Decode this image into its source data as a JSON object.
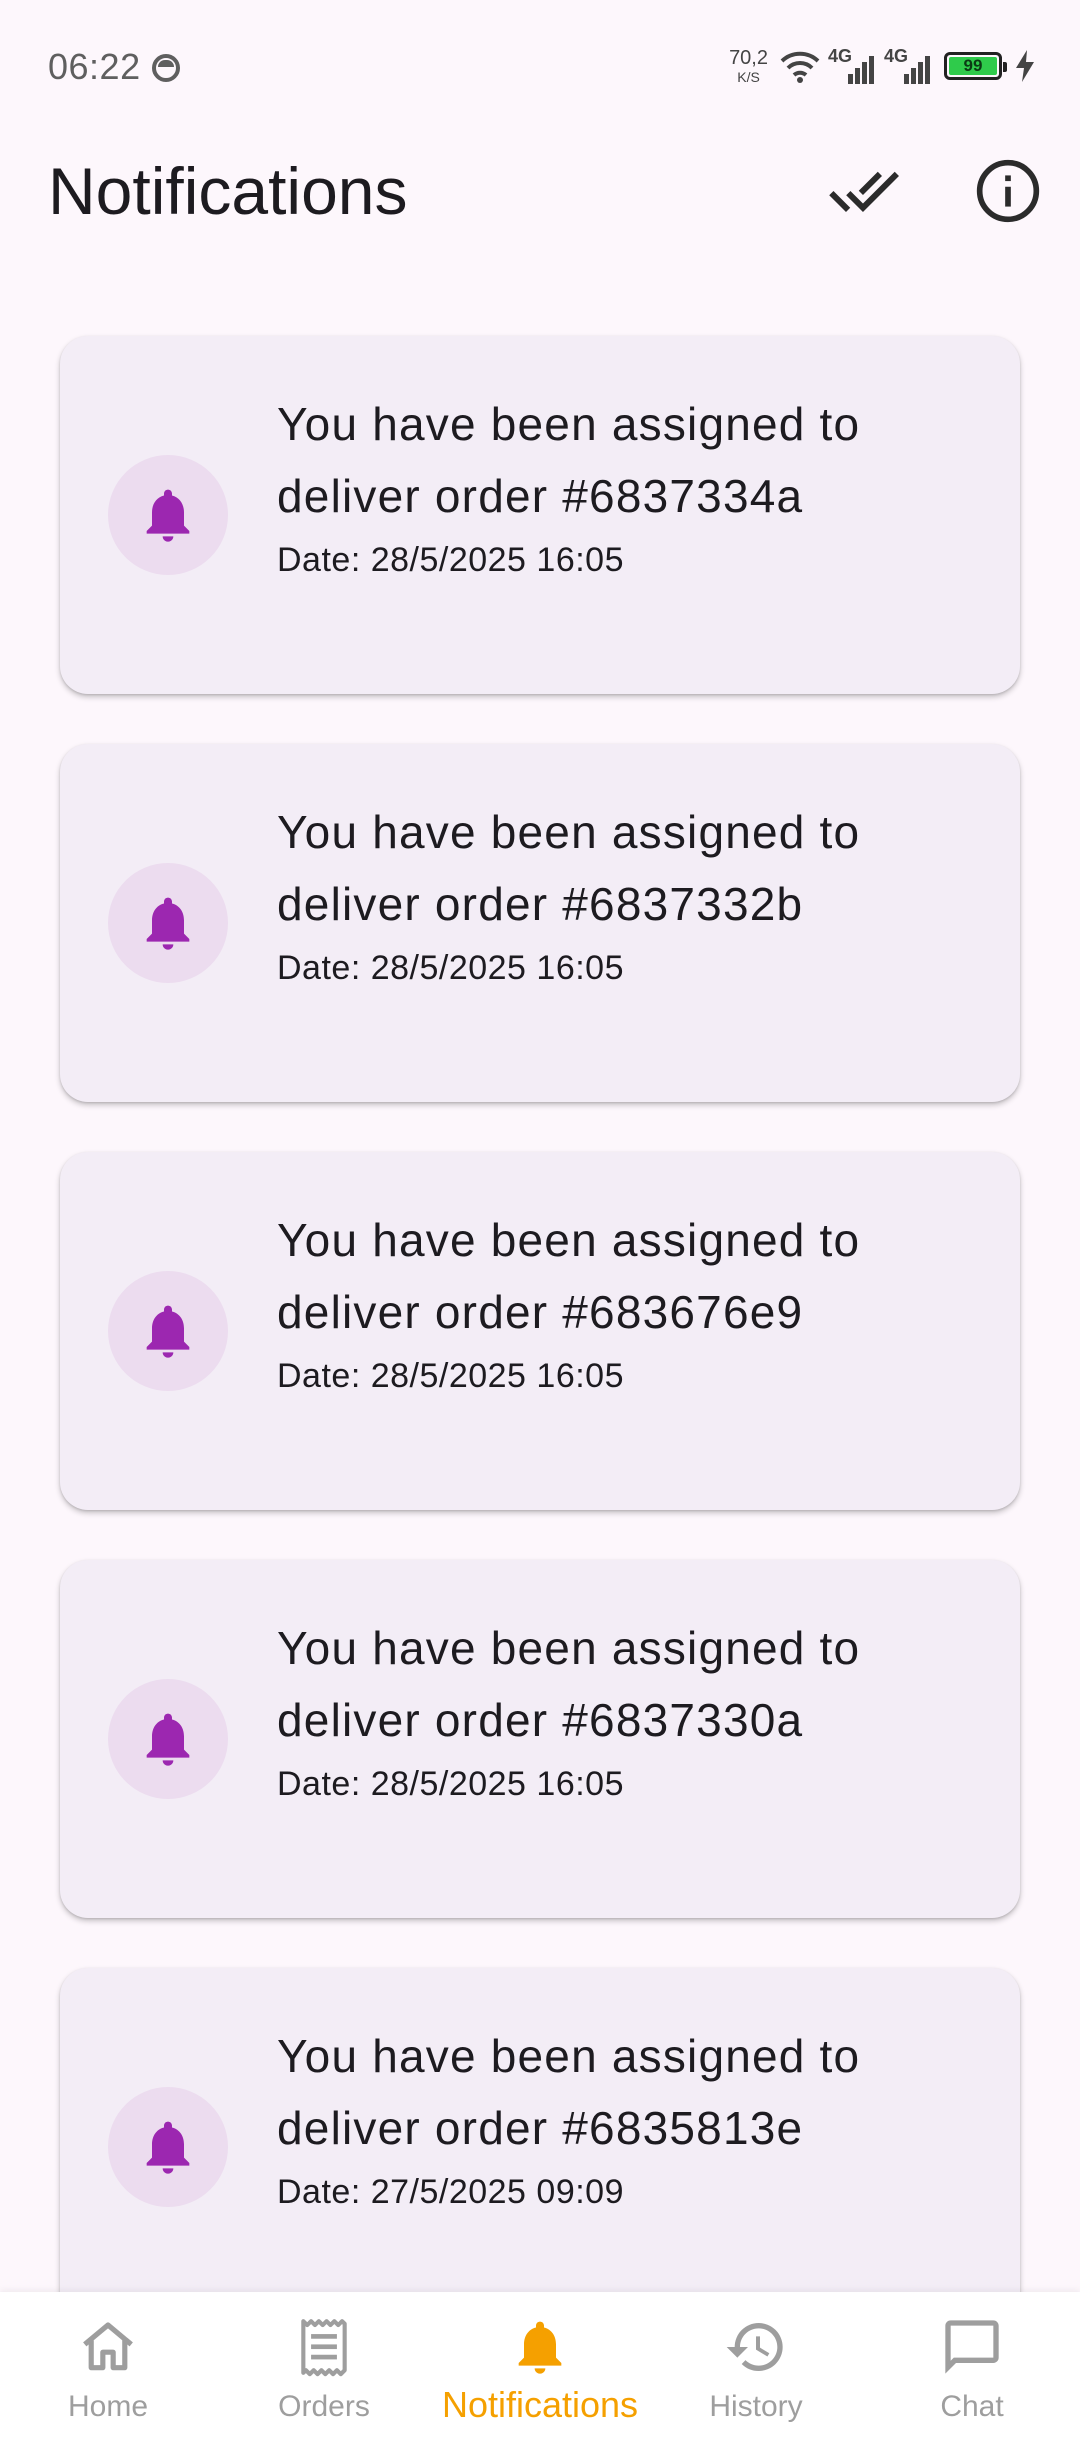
{
  "status_bar": {
    "time": "06:22",
    "net_speed_value": "70,2",
    "net_speed_unit": "K/S",
    "network_1": "4G",
    "network_2": "4G",
    "battery": "99"
  },
  "header": {
    "title": "Notifications",
    "actions": [
      {
        "icon": "done-all-icon"
      },
      {
        "icon": "info-icon"
      }
    ]
  },
  "notifications": [
    {
      "title": "You have been assigned to deliver order #6837334a",
      "date": "Date: 28/5/2025 16:05"
    },
    {
      "title": "You have been assigned to deliver order #6837332b",
      "date": "Date: 28/5/2025 16:05"
    },
    {
      "title": "You have been assigned to deliver order #683676e9",
      "date": "Date: 28/5/2025 16:05"
    },
    {
      "title": "You have been assigned to deliver order #6837330a",
      "date": "Date: 28/5/2025 16:05"
    },
    {
      "title": "You have been assigned to deliver order #6835813e",
      "date": "Date: 27/5/2025 09:09"
    }
  ],
  "bottom_nav": {
    "items": [
      {
        "label": "Home",
        "icon": "home-icon"
      },
      {
        "label": "Orders",
        "icon": "receipt-icon"
      },
      {
        "label": "Notifications",
        "icon": "bell-icon",
        "active": true
      },
      {
        "label": "History",
        "icon": "history-icon"
      },
      {
        "label": "Chat",
        "icon": "chat-icon"
      }
    ]
  },
  "colors": {
    "accent": "#f5a000",
    "bell": "#9c27b0",
    "card_bg": "#f3edf6",
    "avatar_bg": "#ecdcef",
    "page_bg": "#fdf7fc"
  }
}
